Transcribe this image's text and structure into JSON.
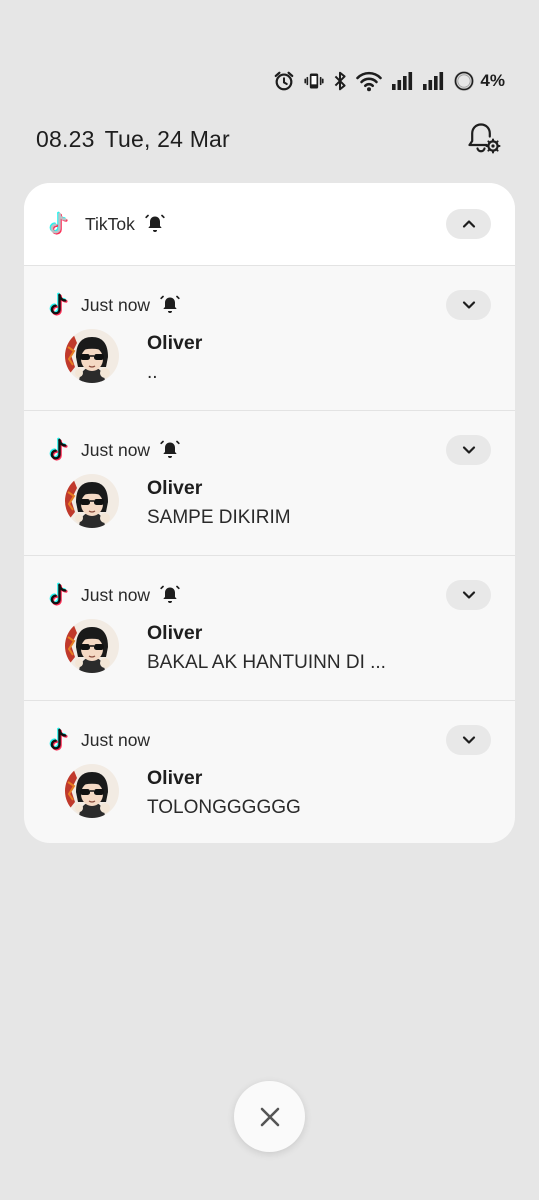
{
  "status_bar": {
    "icons": [
      "alarm-icon",
      "vibrate-icon",
      "bluetooth-icon",
      "wifi-icon",
      "signal-icon-1",
      "signal-icon-2",
      "battery-ring-icon"
    ],
    "battery_percent": "4%",
    "battery_level": 0.04
  },
  "header": {
    "time": "08.23",
    "date": "Tue, 24 Mar",
    "settings_icon": "notification-settings-icon"
  },
  "group": {
    "app_name": "TikTok",
    "app_icon": "tiktok-icon",
    "muted_icon": "bell-off-icon",
    "collapse_icon": "chevron-up-icon"
  },
  "notifications": [
    {
      "time": "Just now",
      "muted": true,
      "sender": "Oliver",
      "message": ".."
    },
    {
      "time": "Just now",
      "muted": true,
      "sender": "Oliver",
      "message": "SAMPE DIKIRIM"
    },
    {
      "time": "Just now",
      "muted": true,
      "sender": "Oliver",
      "message": "BAKAL AK HANTUINN DI ..."
    },
    {
      "time": "Just now",
      "muted": false,
      "sender": "Oliver",
      "message": "TOLONGGGGGG"
    }
  ],
  "footer": {
    "close_icon": "close-icon"
  },
  "colors": {
    "background": "#e6e6e6",
    "card": "#f8f8f8",
    "card_header": "#ffffff",
    "tiktok_cyan": "#25f4ee",
    "tiktok_red": "#fe2c55"
  }
}
